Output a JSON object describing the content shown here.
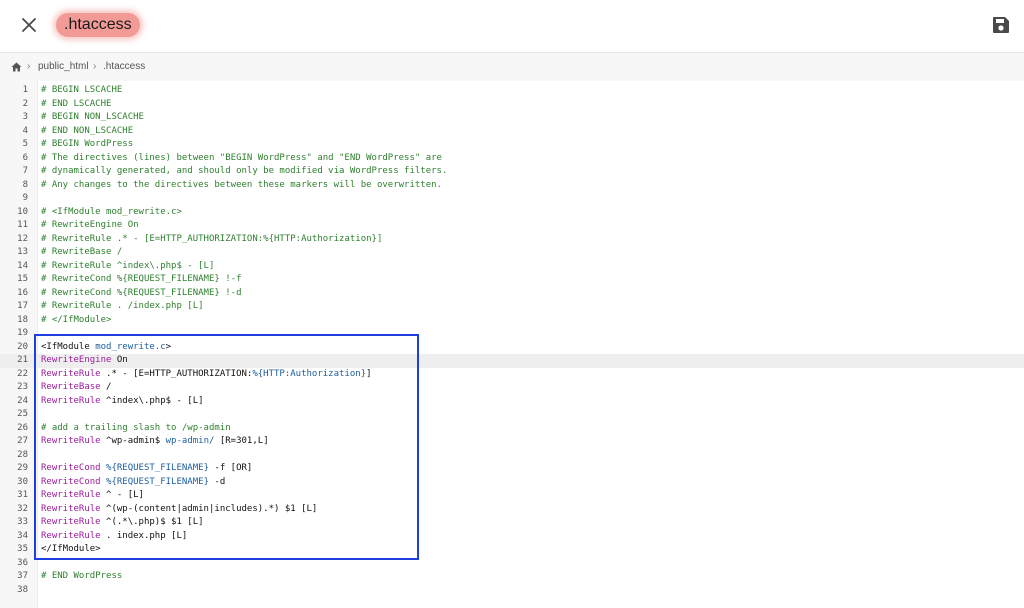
{
  "header": {
    "close_icon": "close-icon",
    "title": ".htaccess",
    "save_icon": "save-icon",
    "title_highlight_color": "#f29a96"
  },
  "breadcrumb": {
    "home_icon": "home-icon",
    "items": [
      "public_html",
      ".htaccess"
    ]
  },
  "editor": {
    "active_line": 21,
    "highlight_color": "#1f3fe0",
    "lines": [
      {
        "n": "1",
        "tokens": [
          {
            "t": "c",
            "s": "# BEGIN LSCACHE"
          }
        ]
      },
      {
        "n": "2",
        "tokens": [
          {
            "t": "c",
            "s": "# END LSCACHE"
          }
        ]
      },
      {
        "n": "3",
        "tokens": [
          {
            "t": "c",
            "s": "# BEGIN NON_LSCACHE"
          }
        ]
      },
      {
        "n": "4",
        "tokens": [
          {
            "t": "c",
            "s": "# END NON_LSCACHE"
          }
        ]
      },
      {
        "n": "5",
        "tokens": [
          {
            "t": "c",
            "s": "# BEGIN WordPress"
          }
        ]
      },
      {
        "n": "6",
        "tokens": [
          {
            "t": "c",
            "s": "# The directives (lines) between \"BEGIN WordPress\" and \"END WordPress\" are"
          }
        ]
      },
      {
        "n": "7",
        "tokens": [
          {
            "t": "c",
            "s": "# dynamically generated, and should only be modified via WordPress filters."
          }
        ]
      },
      {
        "n": "8",
        "tokens": [
          {
            "t": "c",
            "s": "# Any changes to the directives between these markers will be overwritten."
          }
        ]
      },
      {
        "n": "9",
        "tokens": []
      },
      {
        "n": "10",
        "tokens": [
          {
            "t": "c",
            "s": "# <IfModule mod_rewrite.c>"
          }
        ]
      },
      {
        "n": "11",
        "tokens": [
          {
            "t": "c",
            "s": "# RewriteEngine On"
          }
        ]
      },
      {
        "n": "12",
        "tokens": [
          {
            "t": "c",
            "s": "# RewriteRule .* - [E=HTTP_AUTHORIZATION:%{HTTP:Authorization}]"
          }
        ]
      },
      {
        "n": "13",
        "tokens": [
          {
            "t": "c",
            "s": "# RewriteBase /"
          }
        ]
      },
      {
        "n": "14",
        "tokens": [
          {
            "t": "c",
            "s": "# RewriteRule ^index\\.php$ - [L]"
          }
        ]
      },
      {
        "n": "15",
        "tokens": [
          {
            "t": "c",
            "s": "# RewriteCond %{REQUEST_FILENAME} !-f"
          }
        ]
      },
      {
        "n": "16",
        "tokens": [
          {
            "t": "c",
            "s": "# RewriteCond %{REQUEST_FILENAME} !-d"
          }
        ]
      },
      {
        "n": "17",
        "tokens": [
          {
            "t": "c",
            "s": "# RewriteRule . /index.php [L]"
          }
        ]
      },
      {
        "n": "18",
        "tokens": [
          {
            "t": "c",
            "s": "# </IfModule>"
          }
        ]
      },
      {
        "n": "19",
        "tokens": []
      },
      {
        "n": "20",
        "tokens": [
          {
            "t": "p",
            "s": "<IfModule "
          },
          {
            "t": "v",
            "s": "mod_rewrite.c"
          },
          {
            "t": "p",
            "s": ">"
          }
        ]
      },
      {
        "n": "21",
        "tokens": [
          {
            "t": "k",
            "s": "RewriteEngine"
          },
          {
            "t": "p",
            "s": " On"
          }
        ]
      },
      {
        "n": "22",
        "tokens": [
          {
            "t": "k",
            "s": "RewriteRule"
          },
          {
            "t": "p",
            "s": " .* - [E=HTTP_AUTHORIZATION:"
          },
          {
            "t": "v",
            "s": "%{HTTP:Authorization}"
          },
          {
            "t": "p",
            "s": "]"
          }
        ]
      },
      {
        "n": "23",
        "tokens": [
          {
            "t": "k",
            "s": "RewriteBase"
          },
          {
            "t": "p",
            "s": " /"
          }
        ]
      },
      {
        "n": "24",
        "tokens": [
          {
            "t": "k",
            "s": "RewriteRule"
          },
          {
            "t": "p",
            "s": " ^index\\.php$ - [L]"
          }
        ]
      },
      {
        "n": "25",
        "tokens": []
      },
      {
        "n": "26",
        "tokens": [
          {
            "t": "c",
            "s": "# add a trailing slash to /wp-admin"
          }
        ]
      },
      {
        "n": "27",
        "tokens": [
          {
            "t": "k",
            "s": "RewriteRule"
          },
          {
            "t": "p",
            "s": " ^wp-admin$ "
          },
          {
            "t": "v",
            "s": "wp-admin/"
          },
          {
            "t": "p",
            "s": " [R=301,L]"
          }
        ]
      },
      {
        "n": "28",
        "tokens": []
      },
      {
        "n": "29",
        "tokens": [
          {
            "t": "k",
            "s": "RewriteCond"
          },
          {
            "t": "p",
            "s": " "
          },
          {
            "t": "v",
            "s": "%{REQUEST_FILENAME}"
          },
          {
            "t": "p",
            "s": " -f [OR]"
          }
        ]
      },
      {
        "n": "30",
        "tokens": [
          {
            "t": "k",
            "s": "RewriteCond"
          },
          {
            "t": "p",
            "s": " "
          },
          {
            "t": "v",
            "s": "%{REQUEST_FILENAME}"
          },
          {
            "t": "p",
            "s": " -d"
          }
        ]
      },
      {
        "n": "31",
        "tokens": [
          {
            "t": "k",
            "s": "RewriteRule"
          },
          {
            "t": "p",
            "s": " ^ - [L]"
          }
        ]
      },
      {
        "n": "32",
        "tokens": [
          {
            "t": "k",
            "s": "RewriteRule"
          },
          {
            "t": "p",
            "s": " ^(wp-(content|admin|includes).*) $1 [L]"
          }
        ]
      },
      {
        "n": "33",
        "tokens": [
          {
            "t": "k",
            "s": "RewriteRule"
          },
          {
            "t": "p",
            "s": " ^(.*\\.php)$ $1 [L]"
          }
        ]
      },
      {
        "n": "34",
        "tokens": [
          {
            "t": "k",
            "s": "RewriteRule"
          },
          {
            "t": "p",
            "s": " . index.php [L]"
          }
        ]
      },
      {
        "n": "35",
        "tokens": [
          {
            "t": "p",
            "s": "</IfModule>"
          }
        ]
      },
      {
        "n": "36",
        "tokens": []
      },
      {
        "n": "37",
        "tokens": [
          {
            "t": "c",
            "s": "# END WordPress"
          }
        ]
      },
      {
        "n": "38",
        "tokens": []
      }
    ]
  }
}
